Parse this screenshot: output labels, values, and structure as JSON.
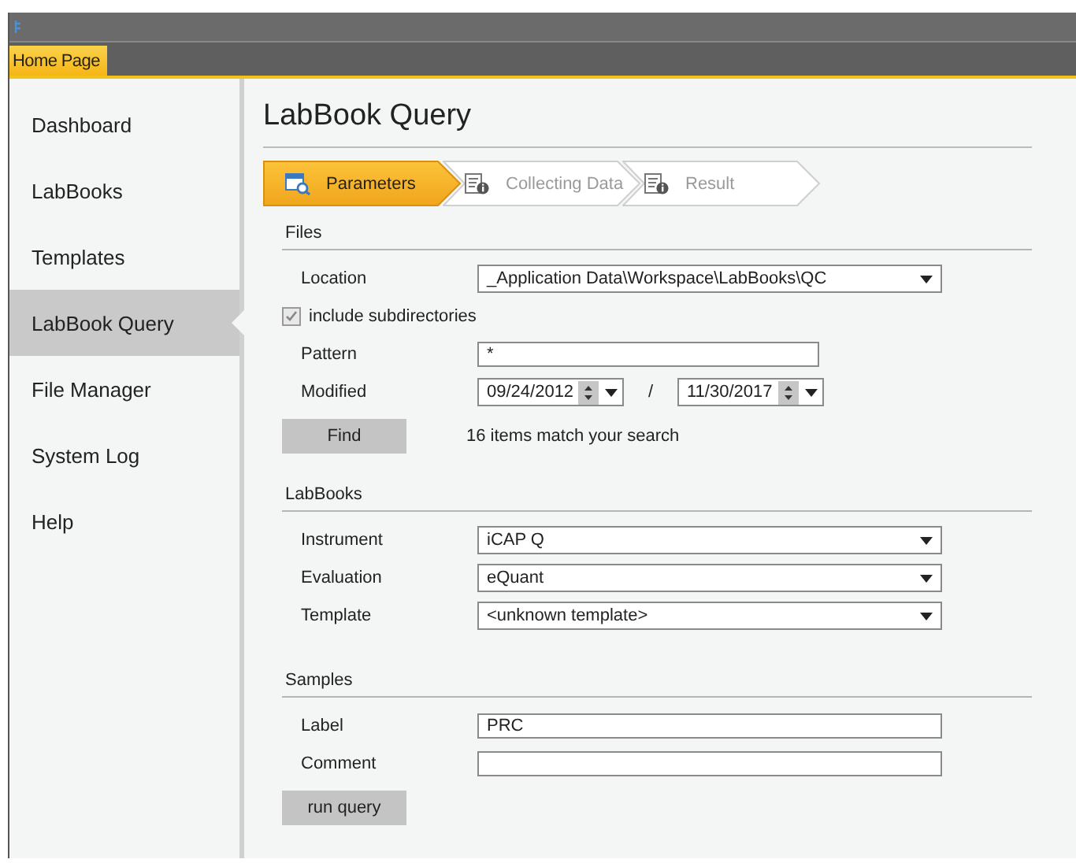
{
  "tabs": [
    {
      "label": "Home Page",
      "selected": true
    }
  ],
  "sidebar": {
    "items": [
      {
        "label": "Dashboard",
        "selected": false
      },
      {
        "label": "LabBooks",
        "selected": false
      },
      {
        "label": "Templates",
        "selected": false
      },
      {
        "label": "LabBook Query",
        "selected": true
      },
      {
        "label": "File Manager",
        "selected": false
      },
      {
        "label": "System Log",
        "selected": false
      },
      {
        "label": "Help",
        "selected": false
      }
    ]
  },
  "page_title": "LabBook Query",
  "steps": [
    {
      "label": "Parameters",
      "selected": true
    },
    {
      "label": "Collecting Data",
      "selected": false
    },
    {
      "label": "Result",
      "selected": false
    }
  ],
  "sections": [
    {
      "title": "Files",
      "rows": [
        {
          "kind": "dropdown",
          "label": "Location",
          "value": "_Application Data\\Workspace\\LabBooks\\QC"
        },
        {
          "kind": "checkbox",
          "label": "include subdirectories",
          "checked": true,
          "disabled": true
        },
        {
          "kind": "short_text",
          "label": "Pattern",
          "value": "*"
        },
        {
          "kind": "daterange",
          "label": "Modified",
          "from": "09/24/2012",
          "separator": "/",
          "to": "11/30/2017"
        },
        {
          "kind": "action",
          "button": "Find",
          "status": "16 items match your search"
        }
      ]
    },
    {
      "title": "LabBooks",
      "rows": [
        {
          "kind": "dropdown",
          "label": "Instrument",
          "value": "iCAP Q"
        },
        {
          "kind": "dropdown",
          "label": "Evaluation",
          "value": "eQuant"
        },
        {
          "kind": "dropdown",
          "label": "Template",
          "value": "<unknown template>"
        }
      ]
    },
    {
      "title": "Samples",
      "rows": [
        {
          "kind": "text",
          "label": "Label",
          "value": "PRC"
        },
        {
          "kind": "text",
          "label": "Comment",
          "value": ""
        },
        {
          "kind": "action",
          "button": "run query"
        }
      ]
    }
  ]
}
